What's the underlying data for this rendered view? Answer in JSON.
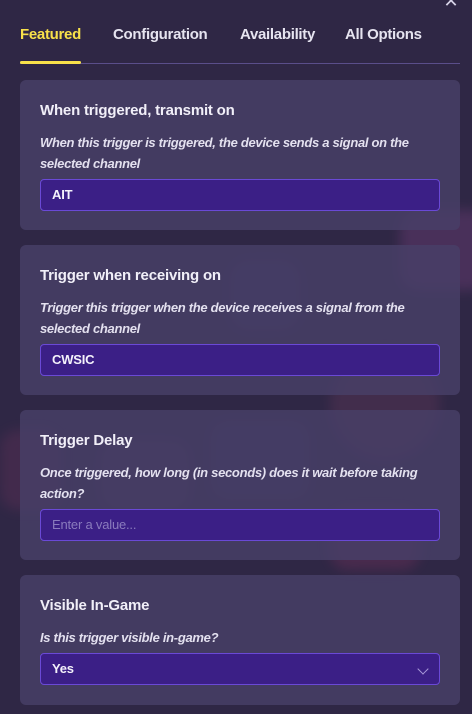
{
  "tabs": [
    {
      "label": "Featured",
      "active": true
    },
    {
      "label": "Configuration",
      "active": false
    },
    {
      "label": "Availability",
      "active": false
    },
    {
      "label": "All Options",
      "active": false
    }
  ],
  "close_icon": "close-icon",
  "colors": {
    "active_tab": "#f8e14a",
    "field_bg": "#3b1f86",
    "field_border": "#6a49d6",
    "card_bg": "#484068"
  },
  "cards": [
    {
      "title": "When triggered, transmit on",
      "description": "When this trigger is triggered, the device sends a signal on the selected channel",
      "value": "AIT",
      "placeholder": ""
    },
    {
      "title": "Trigger when receiving on",
      "description": "Trigger this trigger when the device receives a signal from the selected channel",
      "value": "CWSIC",
      "placeholder": ""
    },
    {
      "title": "Trigger Delay",
      "description": "Once triggered, how long (in seconds) does it wait before taking action?",
      "value": "",
      "placeholder": "Enter a value..."
    },
    {
      "title": "Visible In-Game",
      "description": "Is this trigger visible in-game?",
      "value": "Yes",
      "icon": "chevron-down-icon"
    }
  ]
}
